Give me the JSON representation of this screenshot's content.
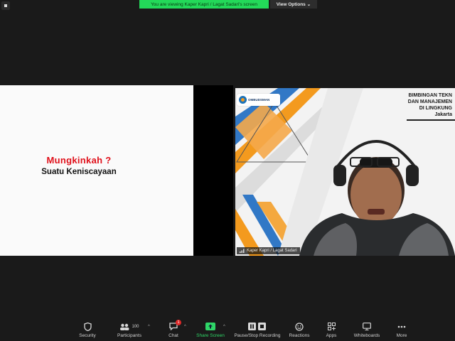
{
  "top": {
    "viewing_banner": "You are viewing Kaper Kapri / Lagat Sadari's screen",
    "view_options": "View Options",
    "view_options_caret": "⌄"
  },
  "slide": {
    "title": "Mungkinkah ?",
    "subtitle": "Suatu Keniscayaan"
  },
  "video": {
    "logo_text": "OMBUDSMAN",
    "banner_lines": [
      "BIMBINGAN TEKN",
      "DAN MANAJEMEN",
      "DI LINGKUNG",
      "Jakarta"
    ],
    "participant_name": "Kaper Kapri / Lagat Sadari"
  },
  "toolbar": {
    "security": "Security",
    "participants": "Participants",
    "participants_count": "100",
    "chat": "Chat",
    "chat_badge": "1",
    "share_screen": "Share Screen",
    "record": "Pause/Stop Recording",
    "reactions": "Reactions",
    "apps": "Apps",
    "whiteboards": "Whiteboards",
    "more": "More",
    "caret": "^"
  },
  "colors": {
    "accent_green": "#23d959",
    "slide_title_red": "#e0101a",
    "toolbar_bg": "#1a1a1a",
    "orange": "#f39a1e",
    "blue": "#1c72b8"
  }
}
